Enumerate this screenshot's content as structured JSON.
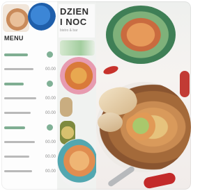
{
  "logo": {
    "line1": "DZIEN",
    "line2": "I NOC",
    "tagline": "bistro & bar"
  },
  "menu": {
    "heading": "MENU",
    "rows": [
      {
        "kind": "section",
        "price": ""
      },
      {
        "kind": "item",
        "price": "00.00"
      },
      {
        "kind": "section",
        "price": ""
      },
      {
        "kind": "item",
        "price": "00.00"
      },
      {
        "kind": "item",
        "price": "00.00"
      },
      {
        "kind": "section",
        "price": ""
      },
      {
        "kind": "item",
        "price": "00.00"
      },
      {
        "kind": "item",
        "price": "00.00"
      },
      {
        "kind": "item",
        "price": "00.00"
      }
    ]
  },
  "colors": {
    "accent_green": "#6aa384",
    "chili_red": "#c7322c",
    "bowl_brown": "#a46a3a"
  }
}
